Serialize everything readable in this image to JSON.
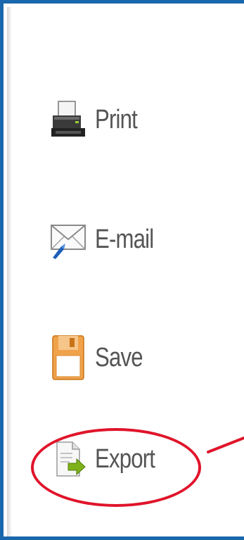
{
  "menu": {
    "items": [
      {
        "label": "Print",
        "icon": "printer-icon"
      },
      {
        "label": "E-mail",
        "icon": "email-icon"
      },
      {
        "label": "Save",
        "icon": "floppy-disk-icon"
      },
      {
        "label": "Export",
        "icon": "export-icon"
      }
    ]
  },
  "annotation": {
    "color": "#e0142a",
    "target": "Export"
  },
  "colors": {
    "border": "#1a67ad",
    "label": "#555555"
  }
}
